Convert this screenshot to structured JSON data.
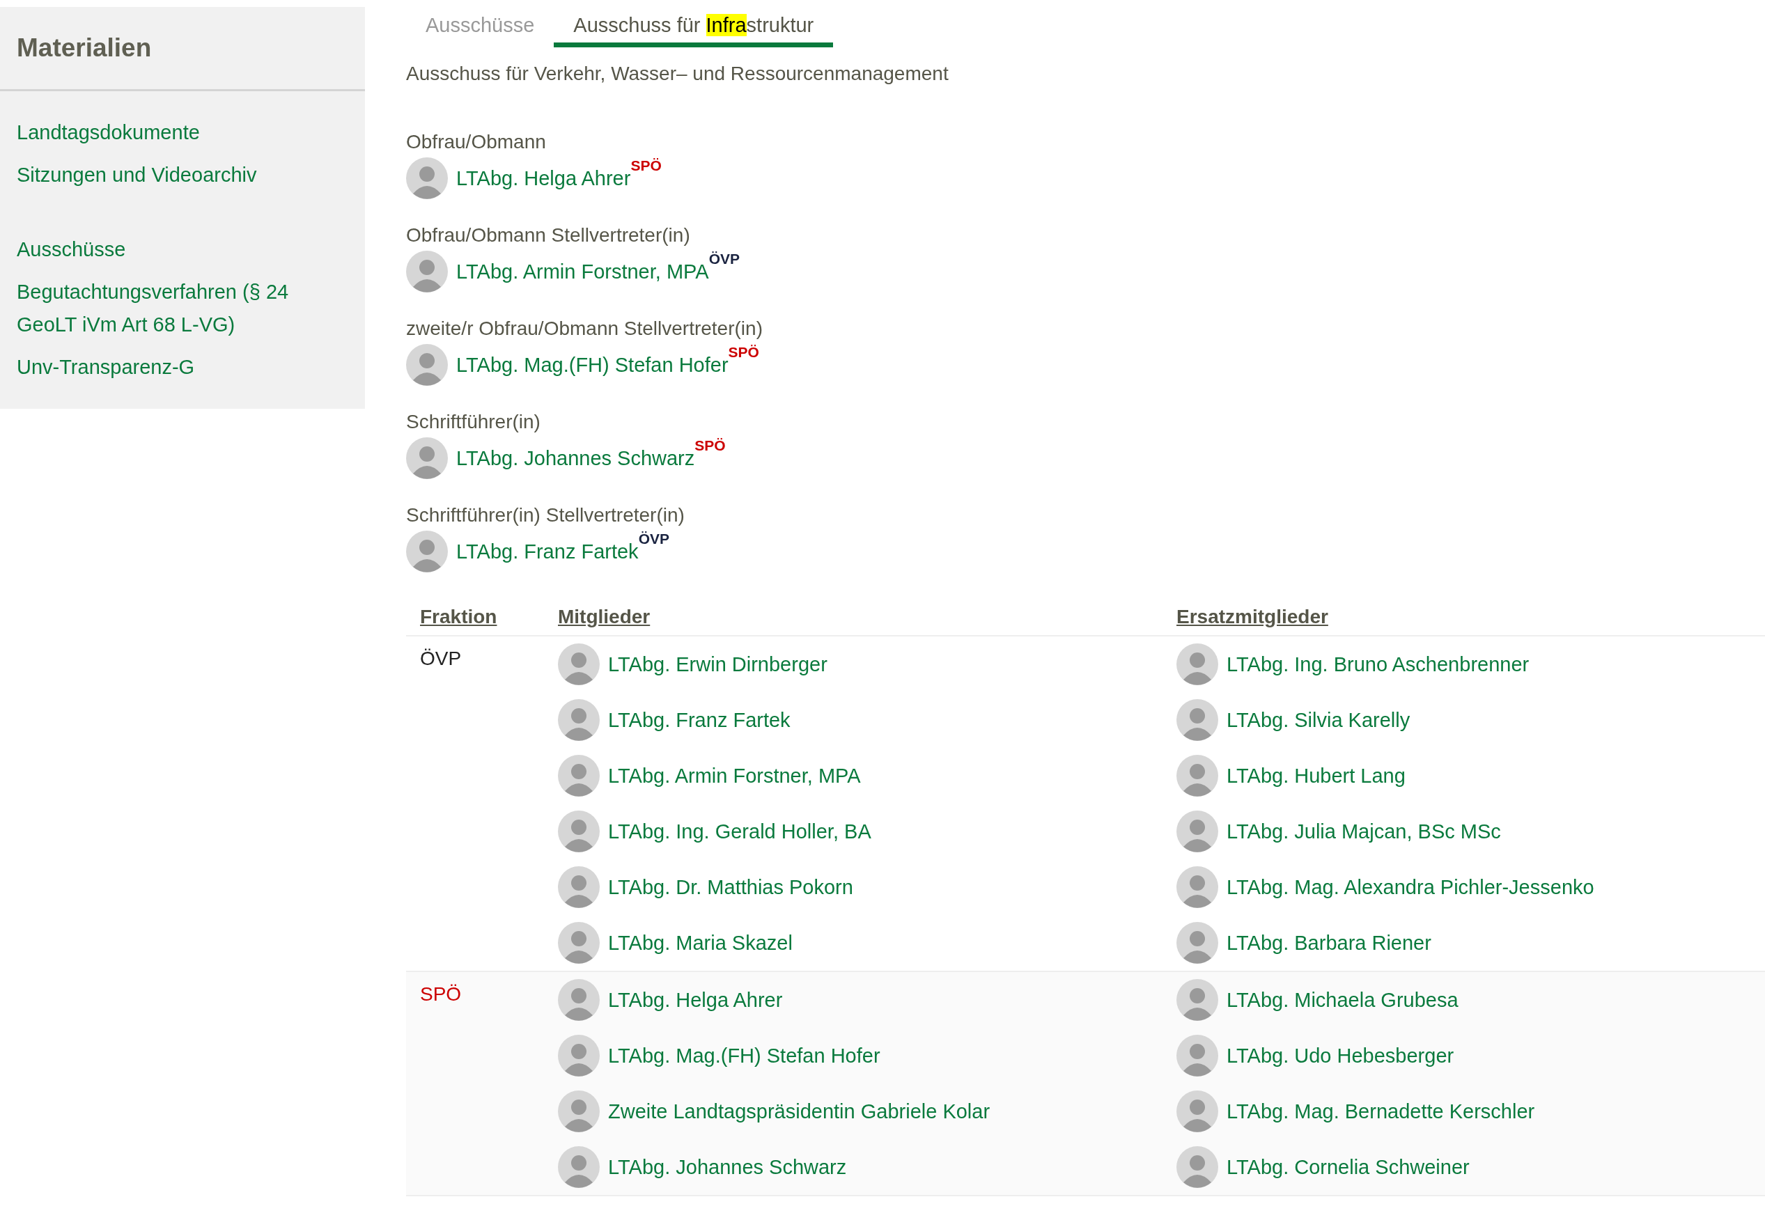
{
  "sidebar": {
    "title": "Materialien",
    "groups": [
      {
        "items": [
          "Landtagsdokumente",
          "Sitzungen und Videoarchiv"
        ]
      },
      {
        "items": [
          "Ausschüsse",
          "Begutachtungsverfahren (§ 24 GeoLT iVm Art 68 L-VG)",
          "Unv-Transparenz-G"
        ]
      }
    ]
  },
  "tabs": [
    {
      "selected": false,
      "parts": [
        {
          "text": "Ausschüsse",
          "highlighted": false
        }
      ]
    },
    {
      "selected": true,
      "parts": [
        {
          "text": "Ausschuss für ",
          "highlighted": false
        },
        {
          "text": "Infra",
          "highlighted": true
        },
        {
          "text": "struktur",
          "highlighted": false
        }
      ]
    }
  ],
  "subtitle": "Ausschuss für Verkehr, Wasser– und Ressourcenmanagement",
  "roles": [
    {
      "role": "Obfrau/Obmann",
      "name": "LTAbg. Helga Ahrer",
      "party": "SPÖ",
      "color": "#cc0000"
    },
    {
      "role": "Obfrau/Obmann Stellvertreter(in)",
      "name": "LTAbg. Armin Forstner, MPA",
      "party": "ÖVP",
      "color": "#1a2340"
    },
    {
      "role": "zweite/r Obfrau/Obmann Stellvertreter(in)",
      "name": "LTAbg. Mag.(FH) Stefan Hofer",
      "party": "SPÖ",
      "color": "#cc0000"
    },
    {
      "role": "Schriftführer(in)",
      "name": "LTAbg. Johannes Schwarz",
      "party": "SPÖ",
      "color": "#cc0000"
    },
    {
      "role": "Schriftführer(in) Stellvertreter(in)",
      "name": "LTAbg. Franz Fartek",
      "party": "ÖVP",
      "color": "#1a2340"
    }
  ],
  "table": {
    "columns": [
      "Fraktion",
      "Mitglieder",
      "Ersatzmitglieder"
    ],
    "groups": [
      {
        "fraktion": "ÖVP",
        "color": "#222222",
        "members": [
          "LTAbg. Erwin Dirnberger",
          "LTAbg. Franz Fartek",
          "LTAbg. Armin Forstner, MPA",
          "LTAbg. Ing. Gerald Holler, BA",
          "LTAbg. Dr. Matthias Pokorn",
          "LTAbg. Maria Skazel"
        ],
        "substitutes": [
          "LTAbg. Ing. Bruno Aschenbrenner",
          "LTAbg. Silvia Karelly",
          "LTAbg. Hubert Lang",
          "LTAbg. Julia Majcan, BSc MSc",
          "LTAbg. Mag. Alexandra Pichler-Jessenko",
          "LTAbg. Barbara Riener"
        ]
      },
      {
        "fraktion": "SPÖ",
        "color": "#cc0000",
        "members": [
          "LTAbg. Helga Ahrer",
          "LTAbg. Mag.(FH) Stefan Hofer",
          "Zweite Landtagspräsidentin Gabriele Kolar",
          "LTAbg. Johannes Schwarz"
        ],
        "substitutes": [
          "LTAbg. Michaela Grubesa",
          "LTAbg. Udo Hebesberger",
          "LTAbg. Mag. Bernadette Kerschler",
          "LTAbg. Cornelia Schweiner"
        ]
      }
    ]
  }
}
